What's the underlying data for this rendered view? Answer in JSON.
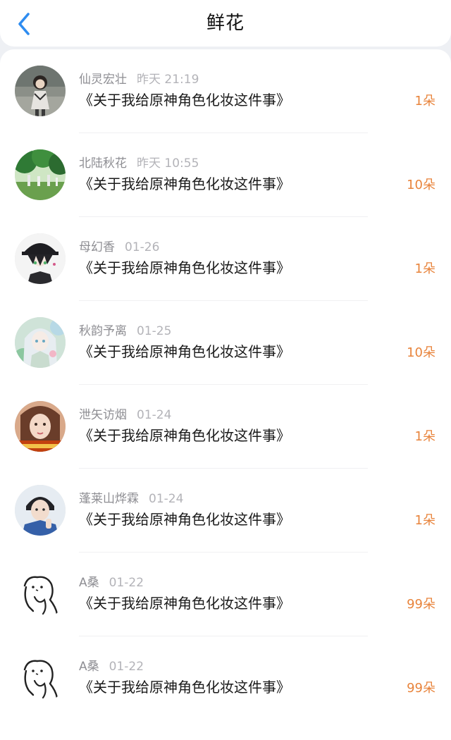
{
  "header": {
    "title": "鲜花"
  },
  "icons": {
    "back": "chevron-left-icon"
  },
  "colors": {
    "accent_blue": "#2e8cf0",
    "flower_count": "#e8843c",
    "name_text": "#8e8e93",
    "time_text": "#b3b3b8"
  },
  "rows": [
    {
      "name": "仙灵宏壮",
      "time": "昨天 21:19",
      "article": "《关于我给原神角色化妆这件事》",
      "count": "1朵"
    },
    {
      "name": "北陆秋花",
      "time": "昨天 10:55",
      "article": "《关于我给原神角色化妆这件事》",
      "count": "10朵"
    },
    {
      "name": "母幻香",
      "time": "01-26",
      "article": "《关于我给原神角色化妆这件事》",
      "count": "1朵"
    },
    {
      "name": "秋韵予离",
      "time": "01-25",
      "article": "《关于我给原神角色化妆这件事》",
      "count": "10朵"
    },
    {
      "name": "泄矢访烟",
      "time": "01-24",
      "article": "《关于我给原神角色化妆这件事》",
      "count": "1朵"
    },
    {
      "name": "蓬莱山烨霖",
      "time": "01-24",
      "article": "《关于我给原神角色化妆这件事》",
      "count": "1朵"
    },
    {
      "name": "A桑",
      "time": "01-22",
      "article": "《关于我给原神角色化妆这件事》",
      "count": "99朵"
    },
    {
      "name": "A桑",
      "time": "01-22",
      "article": "《关于我给原神角色化妆这件事》",
      "count": "99朵"
    }
  ]
}
